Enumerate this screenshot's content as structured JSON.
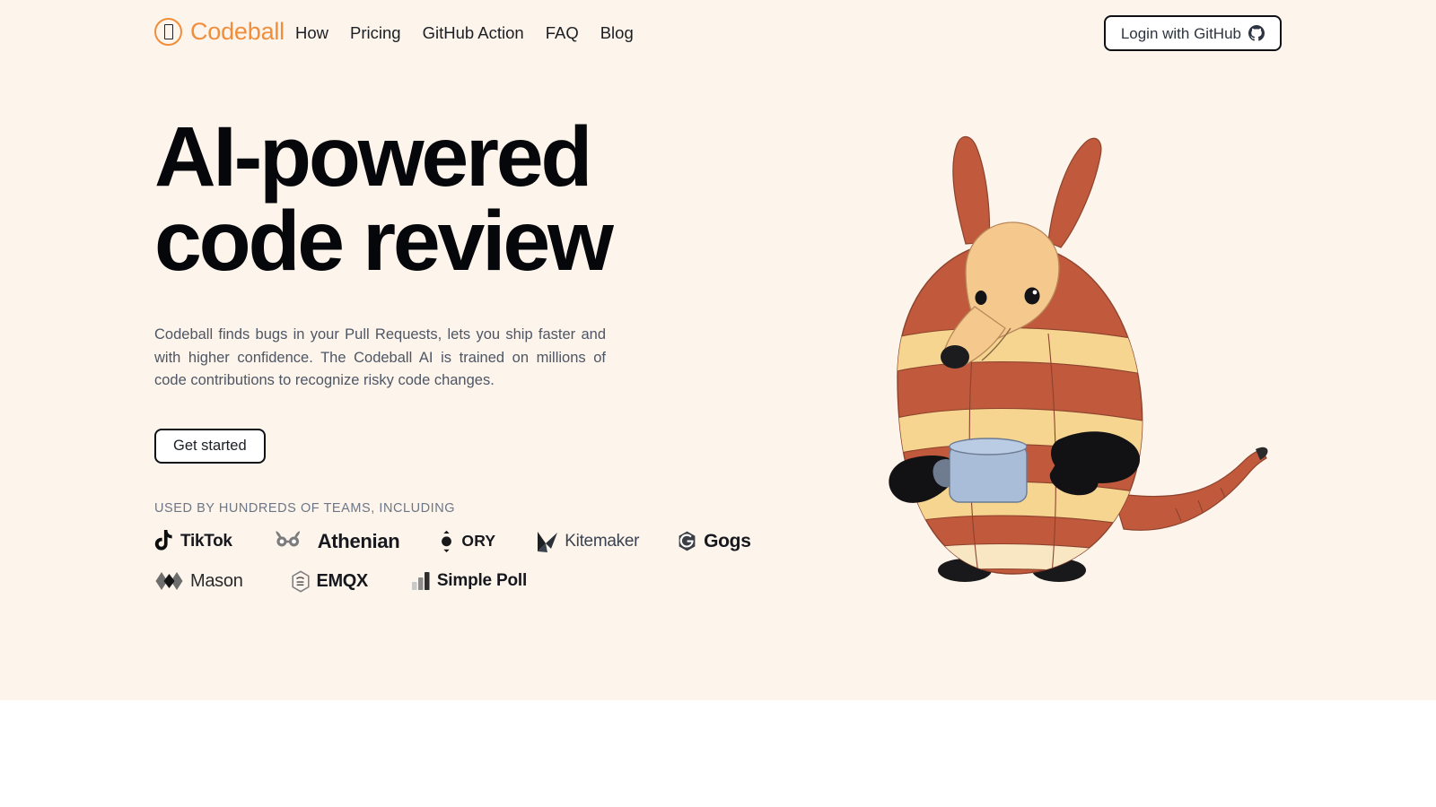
{
  "theme": {
    "hero_bg": "#FDF4EC",
    "page_bg": "#FFFFFF",
    "brand_accent": "#F08E3C",
    "heading_color": "#05070A",
    "body_text_color": "#4E5664",
    "muted_label_color": "#6D7686",
    "outline_color": "#0F1115"
  },
  "nav": {
    "brand": {
      "name": "Codeball",
      "icon": "codeball-logo-icon"
    },
    "links": [
      {
        "label": "How"
      },
      {
        "label": "Pricing"
      },
      {
        "label": "GitHub Action"
      },
      {
        "label": "FAQ"
      },
      {
        "label": "Blog"
      }
    ],
    "login": {
      "label": "Login with GitHub",
      "icon": "github-icon"
    }
  },
  "hero": {
    "headline_line1": "AI-powered",
    "headline_line2": "code review",
    "subtitle": "Codeball finds bugs in your Pull Requests, lets you ship faster and with higher confidence. The Codeball AI is trained on millions of code contributions to recognize risky code changes.",
    "cta_label": "Get started",
    "used_by_label": "USED BY HUNDREDS OF TEAMS, INCLUDING",
    "illustration": "armadillo-with-mug-illustration"
  },
  "customer_logos": {
    "row1": [
      {
        "name": "TikTok",
        "icon": "tiktok-icon"
      },
      {
        "name": "Athenian",
        "icon": "athenian-icon"
      },
      {
        "name": "ORY",
        "icon": "ory-icon"
      },
      {
        "name": "Kitemaker",
        "icon": "kitemaker-icon"
      },
      {
        "name": "Gogs",
        "icon": "gogs-icon"
      }
    ],
    "row2": [
      {
        "name": "Mason",
        "icon": "mason-icon"
      },
      {
        "name": "EMQX",
        "icon": "emqx-icon"
      },
      {
        "name": "Simple Poll",
        "icon": "simple-poll-icon"
      }
    ]
  }
}
